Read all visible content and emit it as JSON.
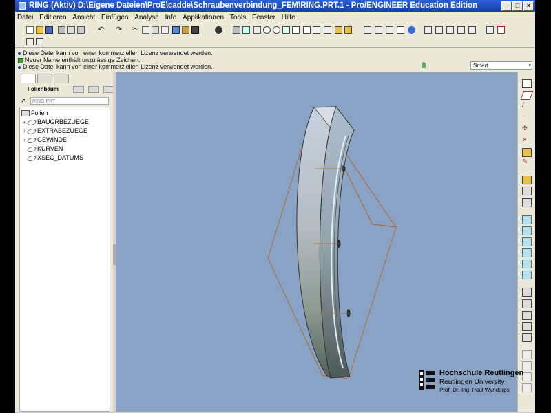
{
  "window": {
    "title": "RING (Aktiv) D:\\Eigene Dateien\\ProE\\cadde\\Schraubenverbindung_FEM\\RING.PRT.1 - Pro/ENGINEER Education Edition",
    "buttons": {
      "minimize": "_",
      "maximize": "□",
      "close": "×"
    }
  },
  "menubar": {
    "items": [
      "Datei",
      "Editieren",
      "Ansicht",
      "Einfügen",
      "Analyse",
      "Info",
      "Applikationen",
      "Tools",
      "Fenster",
      "Hilfe"
    ]
  },
  "messages": [
    {
      "text": "Diese Datei kann von einer kommerziellen Lizenz verwendet werden.",
      "type": "info"
    },
    {
      "text": "Neuer Name enthält unzulässige Zeichen.",
      "type": "warning"
    },
    {
      "text": "Diese Datei kann von einer kommerziellen Lizenz verwendet werden.",
      "type": "info"
    }
  ],
  "filter": {
    "selected": "Smart",
    "arrow": "▾"
  },
  "left_panel": {
    "header_label": "Folienbaum",
    "model_field": "RING.PRT",
    "tree": {
      "root": "Folien",
      "items": [
        {
          "label": "BAUGRBEZUEGE",
          "expandable": true
        },
        {
          "label": "EXTRABEZUEGE",
          "expandable": true
        },
        {
          "label": "GEWINDE",
          "expandable": true
        },
        {
          "label": "KURVEN",
          "expandable": false
        },
        {
          "label": "XSEC_DATUMS",
          "expandable": false
        }
      ]
    }
  },
  "logo": {
    "line1": "Hochschule Reutlingen",
    "line2": "Reutlingen University",
    "line3": "Prof. Dr.-Ing. Paul Wyndorps"
  },
  "colors": {
    "viewport_bg": "#8aa2c6",
    "titlebar": "#1d4bbd",
    "datum_lines": "#b06a2a"
  }
}
